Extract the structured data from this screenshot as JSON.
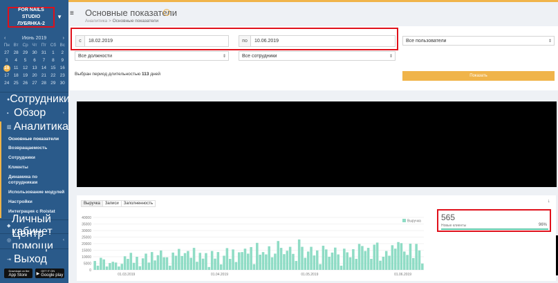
{
  "studio": {
    "line1": "FOR NAILS STUDIO",
    "line2": "ЛУБЯНКА-2"
  },
  "calendar": {
    "prev": "‹",
    "next": "›",
    "month": "Июнь 2019",
    "dows": [
      "Пн",
      "Вт",
      "Ср",
      "Чт",
      "Пт",
      "Сб",
      "Вс"
    ],
    "rows": [
      [
        "27",
        "28",
        "29",
        "30",
        "31",
        "1",
        "2"
      ],
      [
        "3",
        "4",
        "5",
        "6",
        "7",
        "8",
        "9"
      ],
      [
        "10",
        "11",
        "12",
        "13",
        "14",
        "15",
        "16"
      ],
      [
        "17",
        "18",
        "19",
        "20",
        "21",
        "22",
        "23"
      ],
      [
        "24",
        "25",
        "26",
        "27",
        "28",
        "29",
        "30"
      ]
    ],
    "today": "10"
  },
  "nav": {
    "employees": "Сотрудники",
    "overview": "Обзор",
    "analytics": "Аналитика",
    "sub": [
      "Основные показатели",
      "Возвращаемость",
      "Сотрудники",
      "Клиенты",
      "Динамика по сотрудникам",
      "Использование модулей",
      "Настройки",
      "Интеграция с Roistat"
    ],
    "cabinet": "Личный кабинет",
    "help": "Центр помощи",
    "logout": "Выход"
  },
  "stores": {
    "apple_small": "Download on the",
    "apple": "App Store",
    "google_small": "GET IT ON",
    "google": "Google play"
  },
  "header": {
    "title": "Основные показатели",
    "crumb_root": "Аналитика",
    "crumb_sep": ">",
    "crumb_current": "Основные показатели"
  },
  "filters": {
    "from_label": "с",
    "from_value": "18.02.2019",
    "to_label": "по",
    "to_value": "10.06.2019",
    "users": "Все пользователи",
    "positions": "Все должности",
    "employees": "Все сотрудники",
    "period_prefix": "Выбран период длительностью",
    "period_days": "113",
    "period_suffix": "дней",
    "show_button": "Показать"
  },
  "chart_tabs": [
    "Выручка",
    "Записи",
    "Заполненность"
  ],
  "kpi": {
    "value": "565",
    "label": "Новые клиенты",
    "percent": "96%"
  },
  "colors": {
    "accent": "#f0b44a",
    "sidebar": "#2a5a8a",
    "bars": "#8fdcc5",
    "highlight": "#e0101a"
  },
  "chart_data": {
    "type": "bar",
    "legend": "Выручка",
    "xticks": [
      "01.03.2019",
      "01.04.2019",
      "01.05.2019",
      "01.06.2019"
    ],
    "ylim": [
      0,
      40000
    ],
    "yticks": [
      0,
      5000,
      10000,
      15000,
      20000,
      25000,
      30000,
      35000,
      40000
    ],
    "values": [
      6800,
      3200,
      9200,
      8000,
      2600,
      5200,
      6200,
      5600,
      2600,
      4600,
      10400,
      8400,
      13000,
      5400,
      10000,
      2800,
      8800,
      12400,
      5600,
      13600,
      7200,
      11200,
      14800,
      9600,
      9600,
      3200,
      13200,
      10800,
      16000,
      10600,
      12800,
      14400,
      9200,
      16800,
      6200,
      13000,
      8600,
      12800,
      2200,
      14400,
      8600,
      13600,
      4200,
      10800,
      16600,
      8400,
      15600,
      6000,
      13400,
      13600,
      16200,
      12400,
      17400,
      4400,
      20600,
      11600,
      13600,
      11800,
      18000,
      9600,
      12400,
      22000,
      16800,
      12000,
      14600,
      17600,
      12200,
      6800,
      23200,
      17600,
      9200,
      14000,
      17600,
      11000,
      14800,
      4400,
      18400,
      15600,
      10000,
      13200,
      17000,
      11800,
      3200,
      16200,
      13400,
      9600,
      15800,
      8400,
      19800,
      18200,
      14400,
      16800,
      8400,
      19200,
      20800,
      7000,
      10000,
      14400,
      10800,
      18800,
      16200,
      21200,
      20400,
      14000,
      11400,
      20000,
      9000,
      19800,
      14800,
      4800
    ]
  }
}
